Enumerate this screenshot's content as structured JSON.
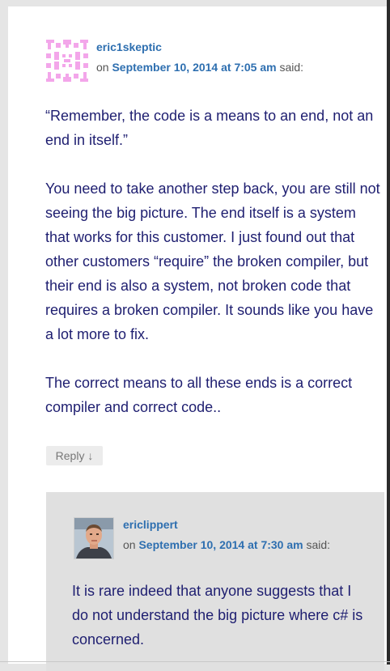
{
  "comment1": {
    "author": "eric1skeptic",
    "on_label": "on",
    "date": "September 10, 2014 at 7:05 am",
    "said_label": "said:",
    "avatar_icon": "identicon-avatar",
    "paragraphs": [
      "“Remember, the code is a means to an end, not an end in itself.”",
      "You need to take another step back, you are still not seeing the big picture. The end itself is a system that works for this customer. I just found out that other customers “require” the broken compiler, but their end is also a system, not broken code that requires a broken compiler. It sounds like you have a lot more to fix.",
      "The correct means to all these ends is a correct compiler and correct code.."
    ],
    "reply_label": "Reply ↓"
  },
  "comment2": {
    "author": "ericlippert",
    "on_label": "on",
    "date": "September 10, 2014 at 7:30 am",
    "said_label": "said:",
    "avatar_icon": "user-photo-avatar",
    "paragraphs": [
      "It is rare indeed that anyone suggests that I do not understand the big picture where c# is concerned."
    ]
  },
  "colors": {
    "link": "#2e6fb0",
    "body_text": "#1e1e70",
    "identicon": "#f3a6ea",
    "reply_bg": "#e0e0e0"
  }
}
